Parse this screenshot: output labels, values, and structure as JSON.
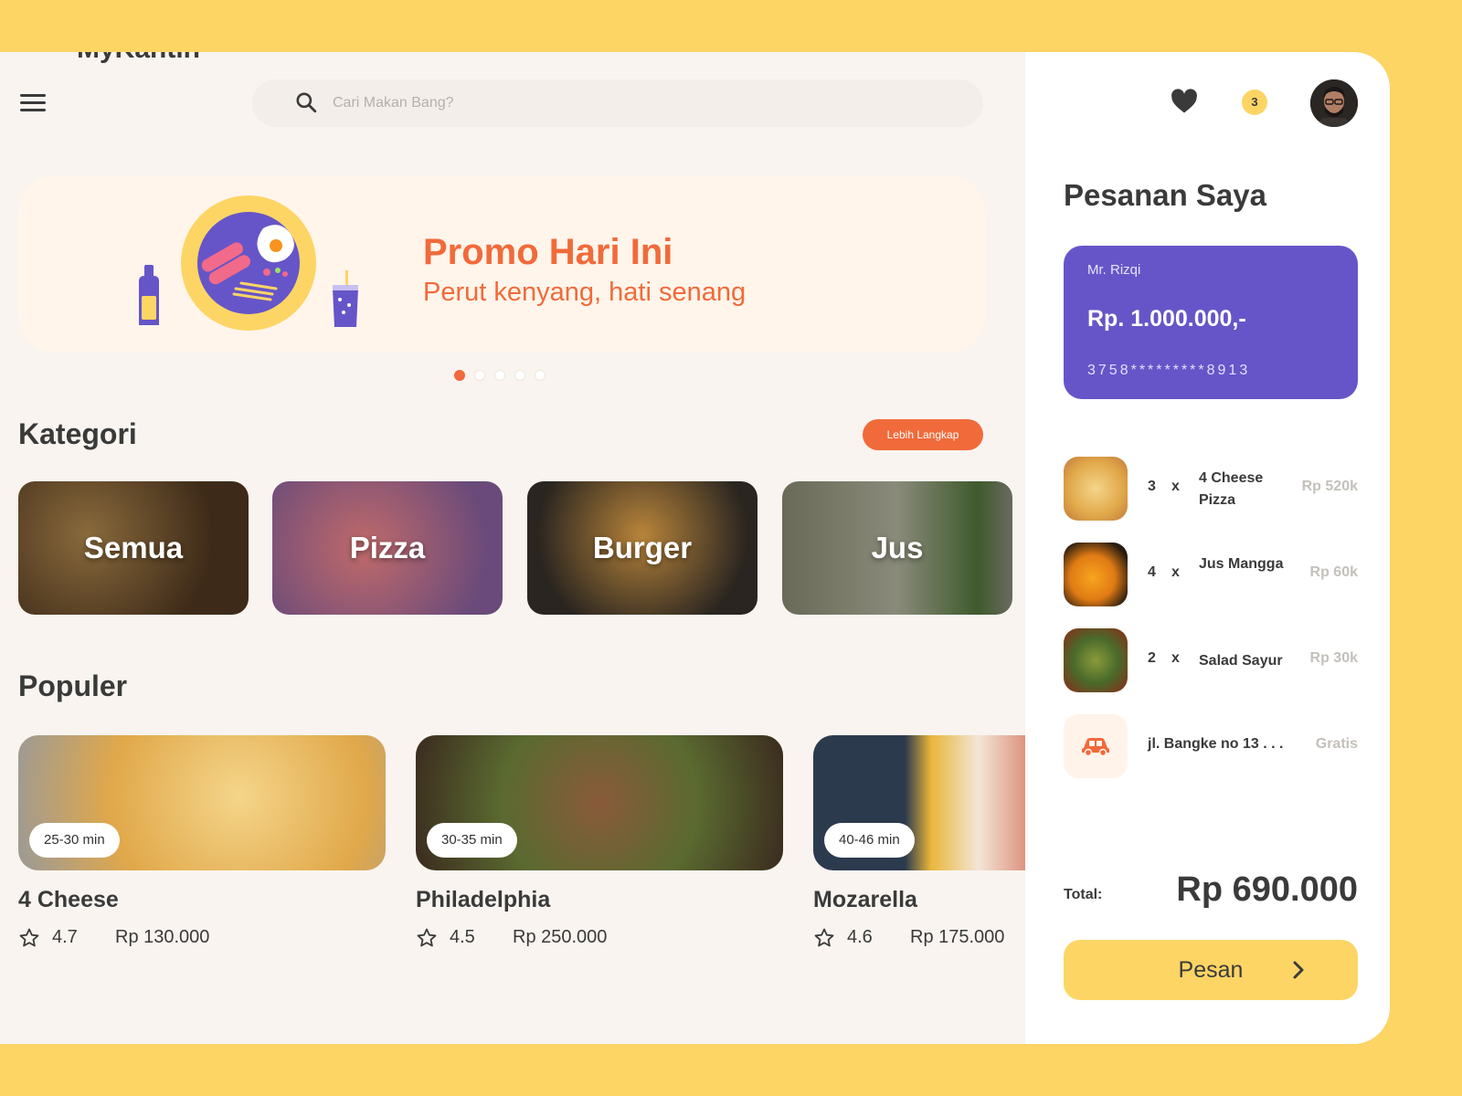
{
  "header": {
    "brand": "MyKantin",
    "search_placeholder": "Cari Makan Bang?",
    "notification_count": "3"
  },
  "banner": {
    "title": "Promo Hari Ini",
    "subtitle": "Perut kenyang, hati senang",
    "slides_total": 5,
    "active_slide": 1
  },
  "kategori": {
    "title": "Kategori",
    "more_label": "Lebih Langkap",
    "items": [
      {
        "label": "Semua"
      },
      {
        "label": "Pizza"
      },
      {
        "label": "Burger"
      },
      {
        "label": "Jus"
      }
    ]
  },
  "populer": {
    "title": "Populer",
    "items": [
      {
        "time": "25-30 min",
        "name": "4 Cheese",
        "rating": "4.7",
        "price": "Rp 130.000"
      },
      {
        "time": "30-35 min",
        "name": "Philadelphia",
        "rating": "4.5",
        "price": "Rp 250.000"
      },
      {
        "time": "40-46 min",
        "name": "Mozarella",
        "rating": "4.6",
        "price": "Rp 175.000"
      }
    ]
  },
  "orders_panel": {
    "title": "Pesanan Saya",
    "card": {
      "holder": "Mr. Rizqi",
      "balance": "Rp. 1.000.000,-",
      "number": "3758*********8913"
    },
    "items": [
      {
        "qty": "3",
        "x": "x",
        "name": "4 Cheese Pizza",
        "price": "Rp 520k"
      },
      {
        "qty": "4",
        "x": "x",
        "name": "Jus Mangga",
        "price": "Rp 60k"
      },
      {
        "qty": "2",
        "x": "x",
        "name": "Salad Sayur",
        "price": "Rp 30k"
      }
    ],
    "delivery": {
      "address": "jl. Bangke no 13 . . .",
      "price": "Gratis"
    },
    "total_label": "Total:",
    "total_value": "Rp 690.000",
    "order_button": "Pesan"
  },
  "colors": {
    "background": "#fdd565",
    "accent_orange": "#f16a3a",
    "card_purple": "#6655c8",
    "button_yellow": "#fdd565"
  }
}
